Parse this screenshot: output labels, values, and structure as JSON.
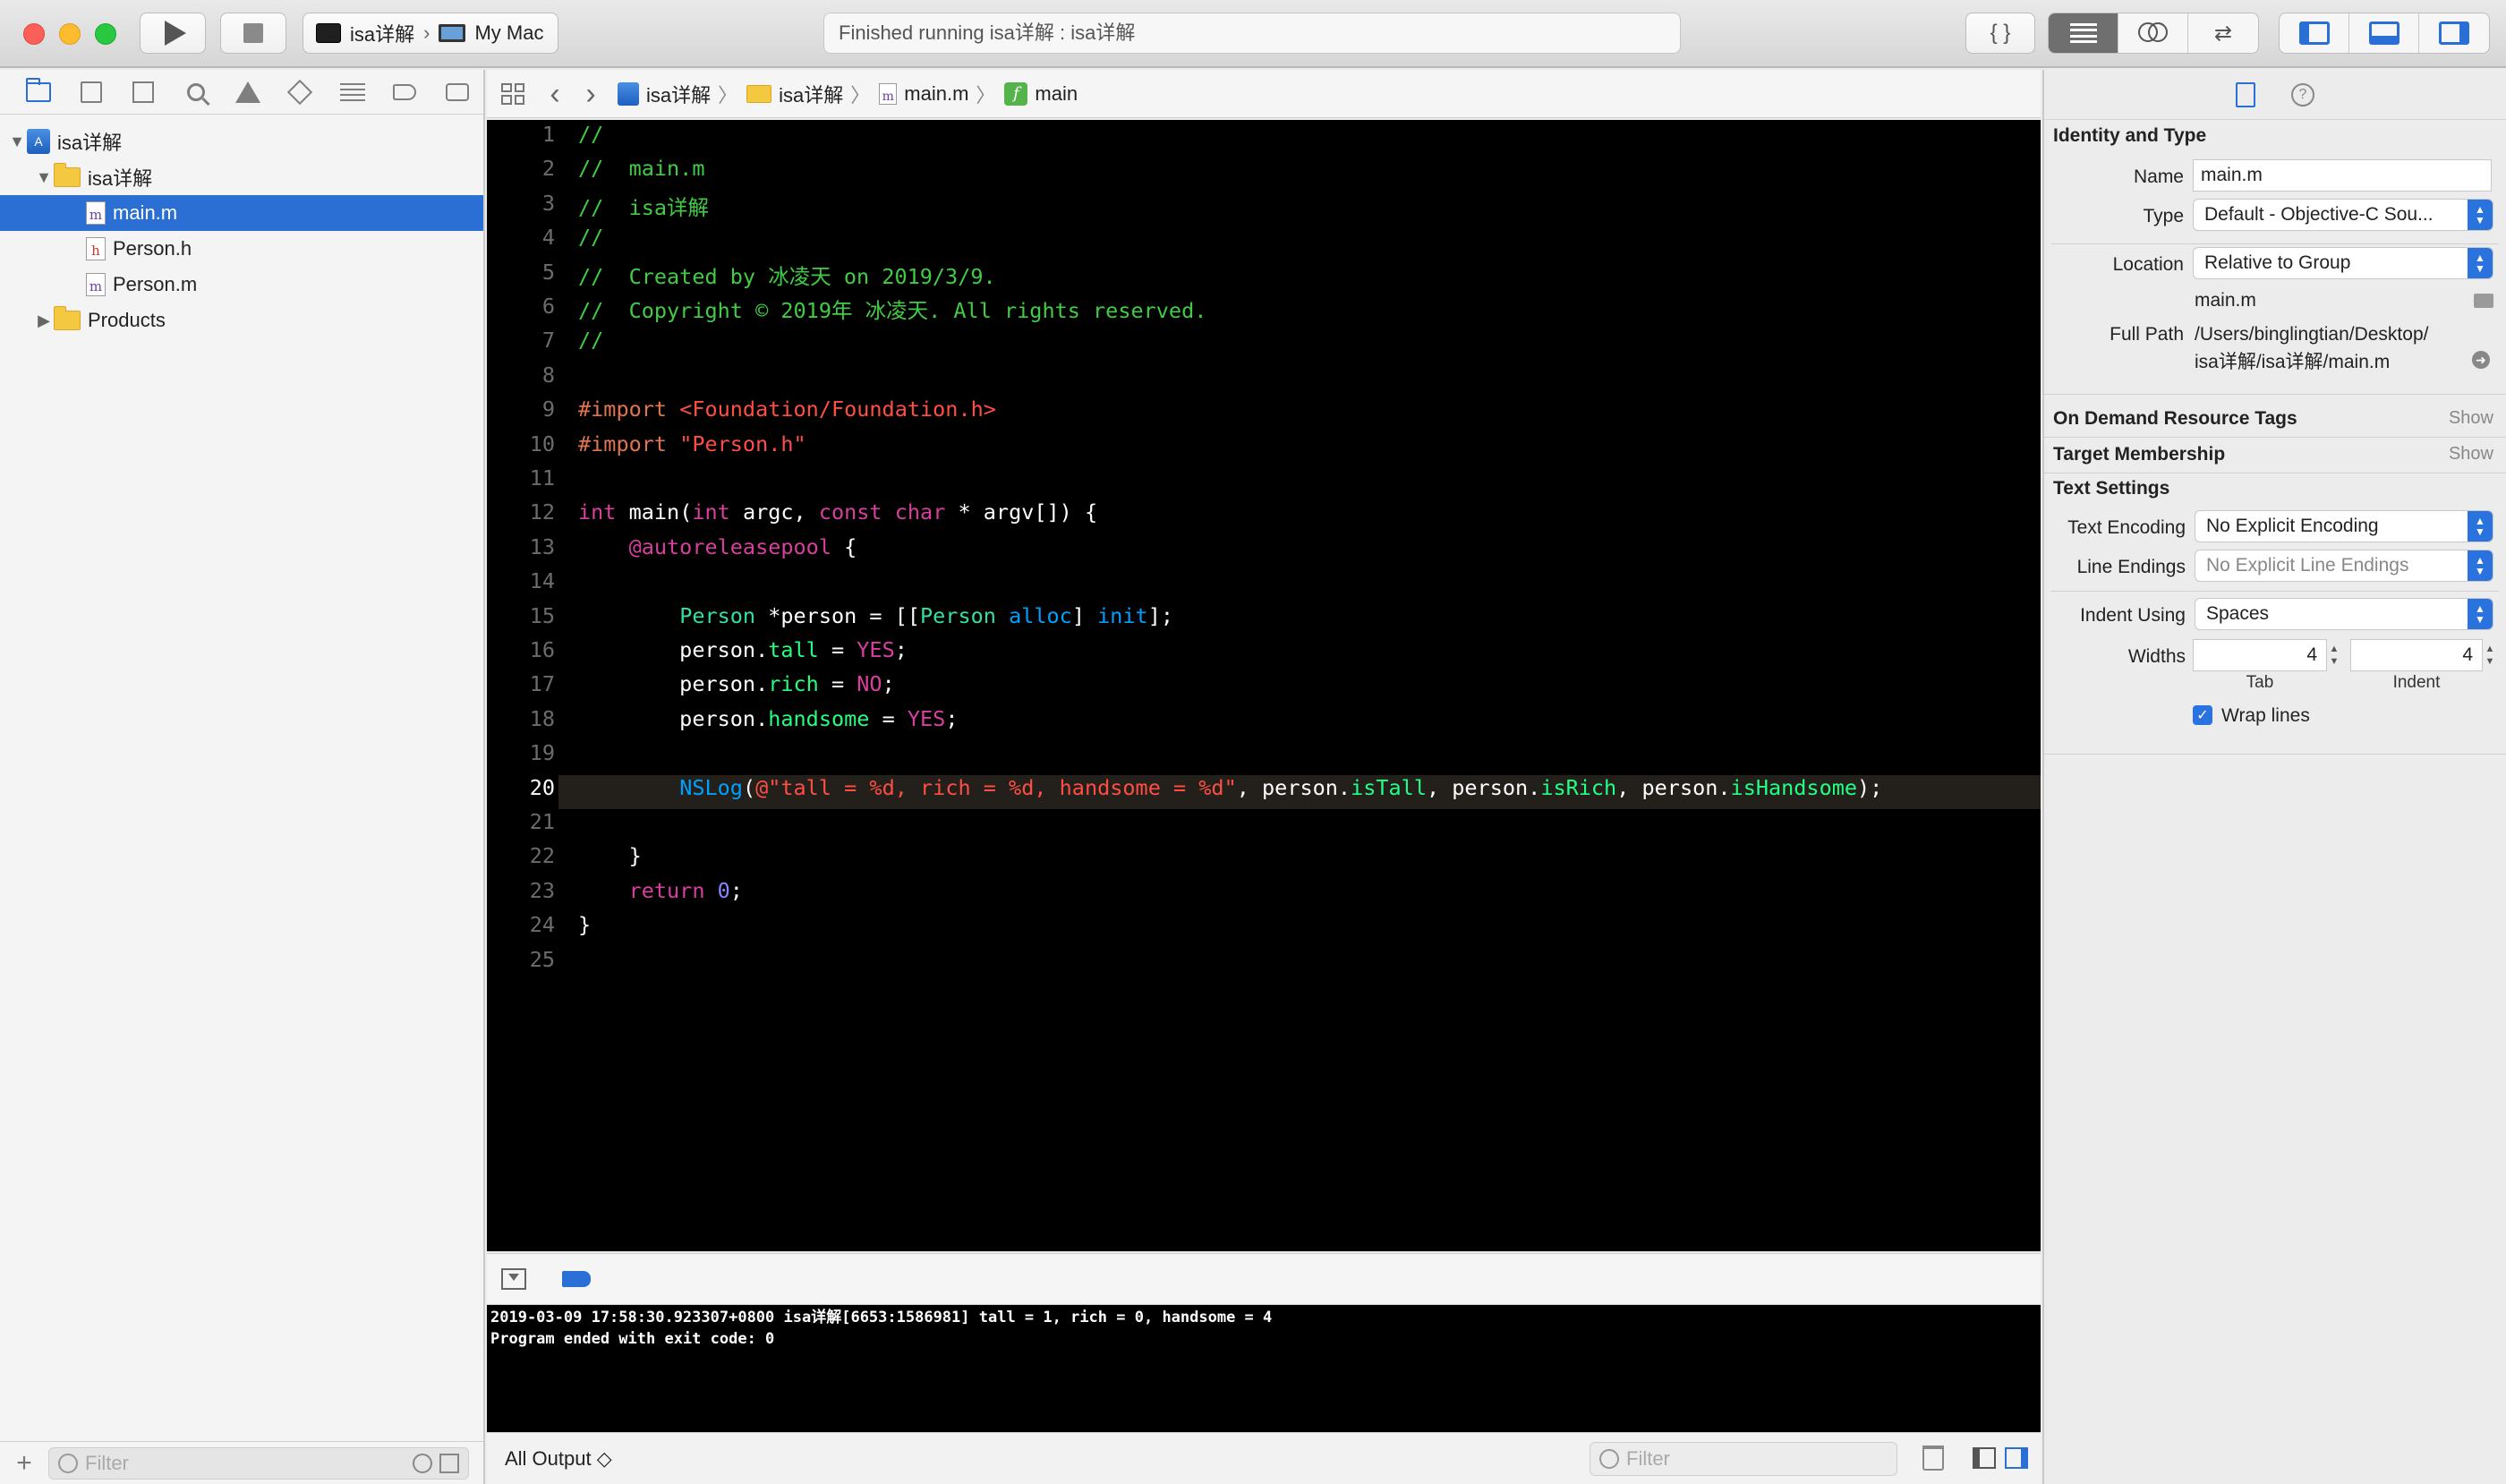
{
  "toolbar": {
    "scheme_name": "isa详解",
    "destination": "My Mac",
    "activity_text": "Finished running isa详解 : isa详解",
    "braces_label": "{ }"
  },
  "navigator": {
    "tree": [
      {
        "label": "isa详解",
        "kind": "project"
      },
      {
        "label": "isa详解",
        "kind": "group"
      },
      {
        "label": "main.m",
        "kind": "file-m",
        "selected": true
      },
      {
        "label": "Person.h",
        "kind": "file-h"
      },
      {
        "label": "Person.m",
        "kind": "file-m"
      },
      {
        "label": "Products",
        "kind": "group"
      }
    ],
    "filter_placeholder": "Filter"
  },
  "jumpbar": {
    "project": "isa详解",
    "group": "isa详解",
    "file": "main.m",
    "symbol": "main"
  },
  "editor": {
    "current_line": 20,
    "lines": [
      "//",
      "//  main.m",
      "//  isa详解",
      "//",
      "//  Created by 冰凌天 on 2019/3/9.",
      "//  Copyright © 2019年 冰凌天. All rights reserved.",
      "//",
      "",
      "#import <Foundation/Foundation.h>",
      "#import \"Person.h\"",
      "",
      "int main(int argc, const char * argv[]) {",
      "    @autoreleasepool {",
      "",
      "        Person *person = [[Person alloc] init];",
      "        person.tall = YES;",
      "        person.rich = NO;",
      "        person.handsome = YES;",
      "",
      "        NSLog(@\"tall = %d, rich = %d, handsome = %d\", person.isTall, person.isRich, person.isHandsome);",
      "",
      "    }",
      "    return 0;",
      "}",
      ""
    ]
  },
  "console": {
    "lines": [
      "2019-03-09 17:58:30.923307+0800 isa详解[6653:1586981] tall = 1, rich = 0, handsome = 4",
      "Program ended with exit code: 0"
    ],
    "output_selector": "All Output ◇",
    "filter_placeholder": "Filter"
  },
  "inspector": {
    "identity_title": "Identity and Type",
    "name_label": "Name",
    "name_value": "main.m",
    "type_label": "Type",
    "type_value": "Default - Objective-C Sou...",
    "location_label": "Location",
    "location_value": "Relative to Group",
    "location_file": "main.m",
    "full_path_label": "Full Path",
    "full_path_line1": "/Users/binglingtian/Desktop/",
    "full_path_line2": "isa详解/isa详解/main.m",
    "odr_title": "On Demand Resource Tags",
    "odr_show": "Show",
    "target_title": "Target Membership",
    "target_show": "Show",
    "text_settings_title": "Text Settings",
    "encoding_label": "Text Encoding",
    "encoding_value": "No Explicit Encoding",
    "endings_label": "Line Endings",
    "endings_value": "No Explicit Line Endings",
    "indent_label": "Indent Using",
    "indent_value": "Spaces",
    "widths_label": "Widths",
    "tab_value": "4",
    "indent_width_value": "4",
    "tab_caption": "Tab",
    "indent_caption": "Indent",
    "wrap_label": "Wrap lines"
  }
}
